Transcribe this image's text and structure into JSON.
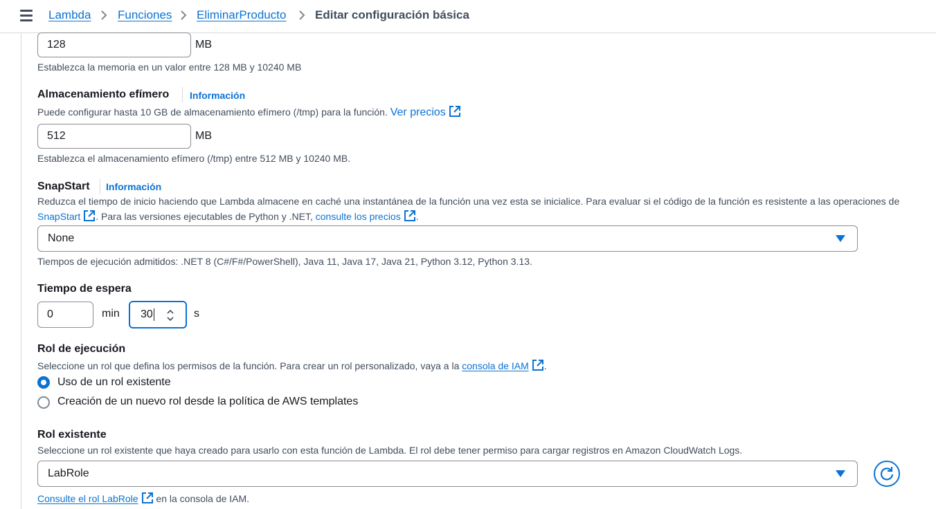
{
  "breadcrumbs": {
    "lambda": "Lambda",
    "functions": "Funciones",
    "function_name": "EliminarProducto",
    "current": "Editar configuración básica"
  },
  "memory": {
    "value": "128",
    "unit": "MB",
    "hint": "Establezca la memoria en un valor entre 128 MB y 10240 MB"
  },
  "ephemeral": {
    "title": "Almacenamiento efímero",
    "info": "Información",
    "desc": "Puede configurar hasta 10 GB de almacenamiento efímero (/tmp) para la función.",
    "pricing_link": "Ver precios",
    "value": "512",
    "unit": "MB",
    "hint": "Establezca el almacenamiento efímero (/tmp) entre 512 MB y 10240 MB."
  },
  "snapstart": {
    "title": "SnapStart",
    "info": "Información",
    "desc": "Reduzca el tiempo de inicio haciendo que Lambda almacene en caché una instantánea de la función una vez esta se inicialice. Para evaluar si el código de la función es resistente a las operaciones de",
    "link1": "SnapStart",
    "desc2": ". Para las versiones ejecutables de Python y .NET,",
    "link2": "consulte los precios",
    "desc3": ".",
    "selected": "None",
    "hint": "Tiempos de ejecución admitidos: .NET 8 (C#/F#/PowerShell), Java 11, Java 17, Java 21, Python 3.12, Python 3.13."
  },
  "timeout": {
    "title": "Tiempo de espera",
    "minutes": "0",
    "min_unit": "min",
    "seconds": "30",
    "sec_unit": "s"
  },
  "role": {
    "title": "Rol de ejecución",
    "desc": "Seleccione un rol que defina los permisos de la función. Para crear un rol personalizado, vaya a la",
    "iam_link": "consola de IAM",
    "desc_end": ".",
    "option_existing": "Uso de un rol existente",
    "option_new": "Creación de un nuevo rol desde la política de AWS templates",
    "selected": "existing"
  },
  "existing_role": {
    "title": "Rol existente",
    "desc": "Seleccione un rol existente que haya creado para usarlo con esta función de Lambda. El rol debe tener permiso para cargar registros en Amazon CloudWatch Logs.",
    "selected": "LabRole",
    "view_link": "Consulte el rol LabRole",
    "view_suffix": "en la consola de IAM."
  },
  "icons": [
    "menu-icon",
    "chevron-right-icon",
    "external-link-icon",
    "caret-down-icon",
    "refresh-icon",
    "spinner-arrows-icon"
  ],
  "colors": {
    "link": "#0972d3",
    "text": "#16191f",
    "secondary": "#414d5c",
    "border": "#8c8c94"
  }
}
